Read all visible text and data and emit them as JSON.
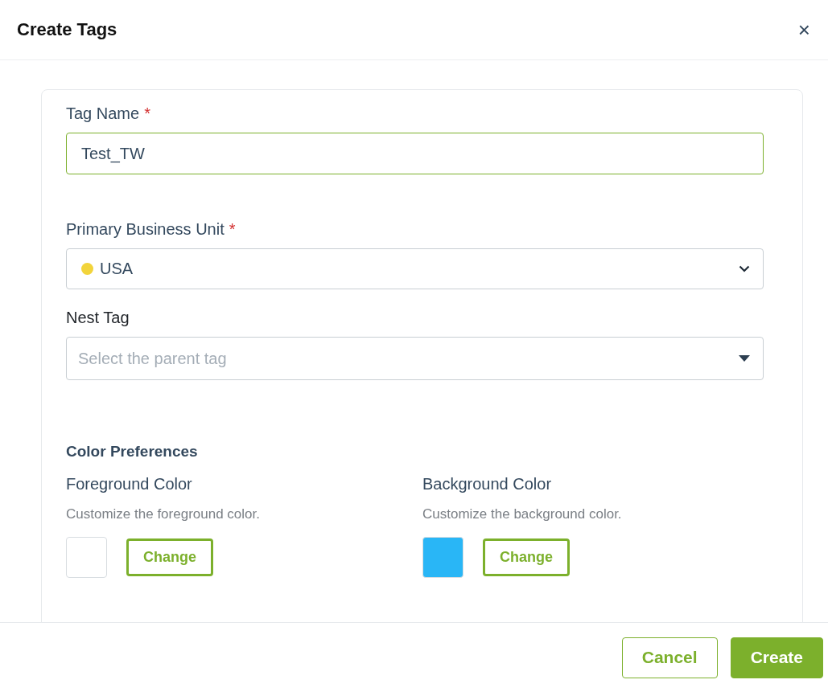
{
  "dialog": {
    "title": "Create Tags",
    "close": "×"
  },
  "fields": [
    {
      "kind": "text",
      "label": "Tag Name",
      "required_mark": "*",
      "value": "Test_TW",
      "focused": true
    },
    {
      "kind": "select",
      "label": "Primary Business Unit",
      "required_mark": "*",
      "value": "USA",
      "color": "#f2d43b"
    },
    {
      "kind": "combo",
      "label": "Nest Tag",
      "placeholder": "Select the parent tag"
    }
  ],
  "color_preferences": {
    "title": "Color Preferences",
    "items": [
      {
        "label": "Foreground Color",
        "hint": "Customize the foreground color.",
        "color": "#ffffff",
        "button": "Change"
      },
      {
        "label": "Background Color",
        "hint": "Customize the background color.",
        "color": "#29b6f6",
        "button": "Change"
      }
    ]
  },
  "buttons": [
    {
      "label": "Cancel",
      "kind": "secondary"
    },
    {
      "label": "Create",
      "kind": "primary"
    }
  ]
}
